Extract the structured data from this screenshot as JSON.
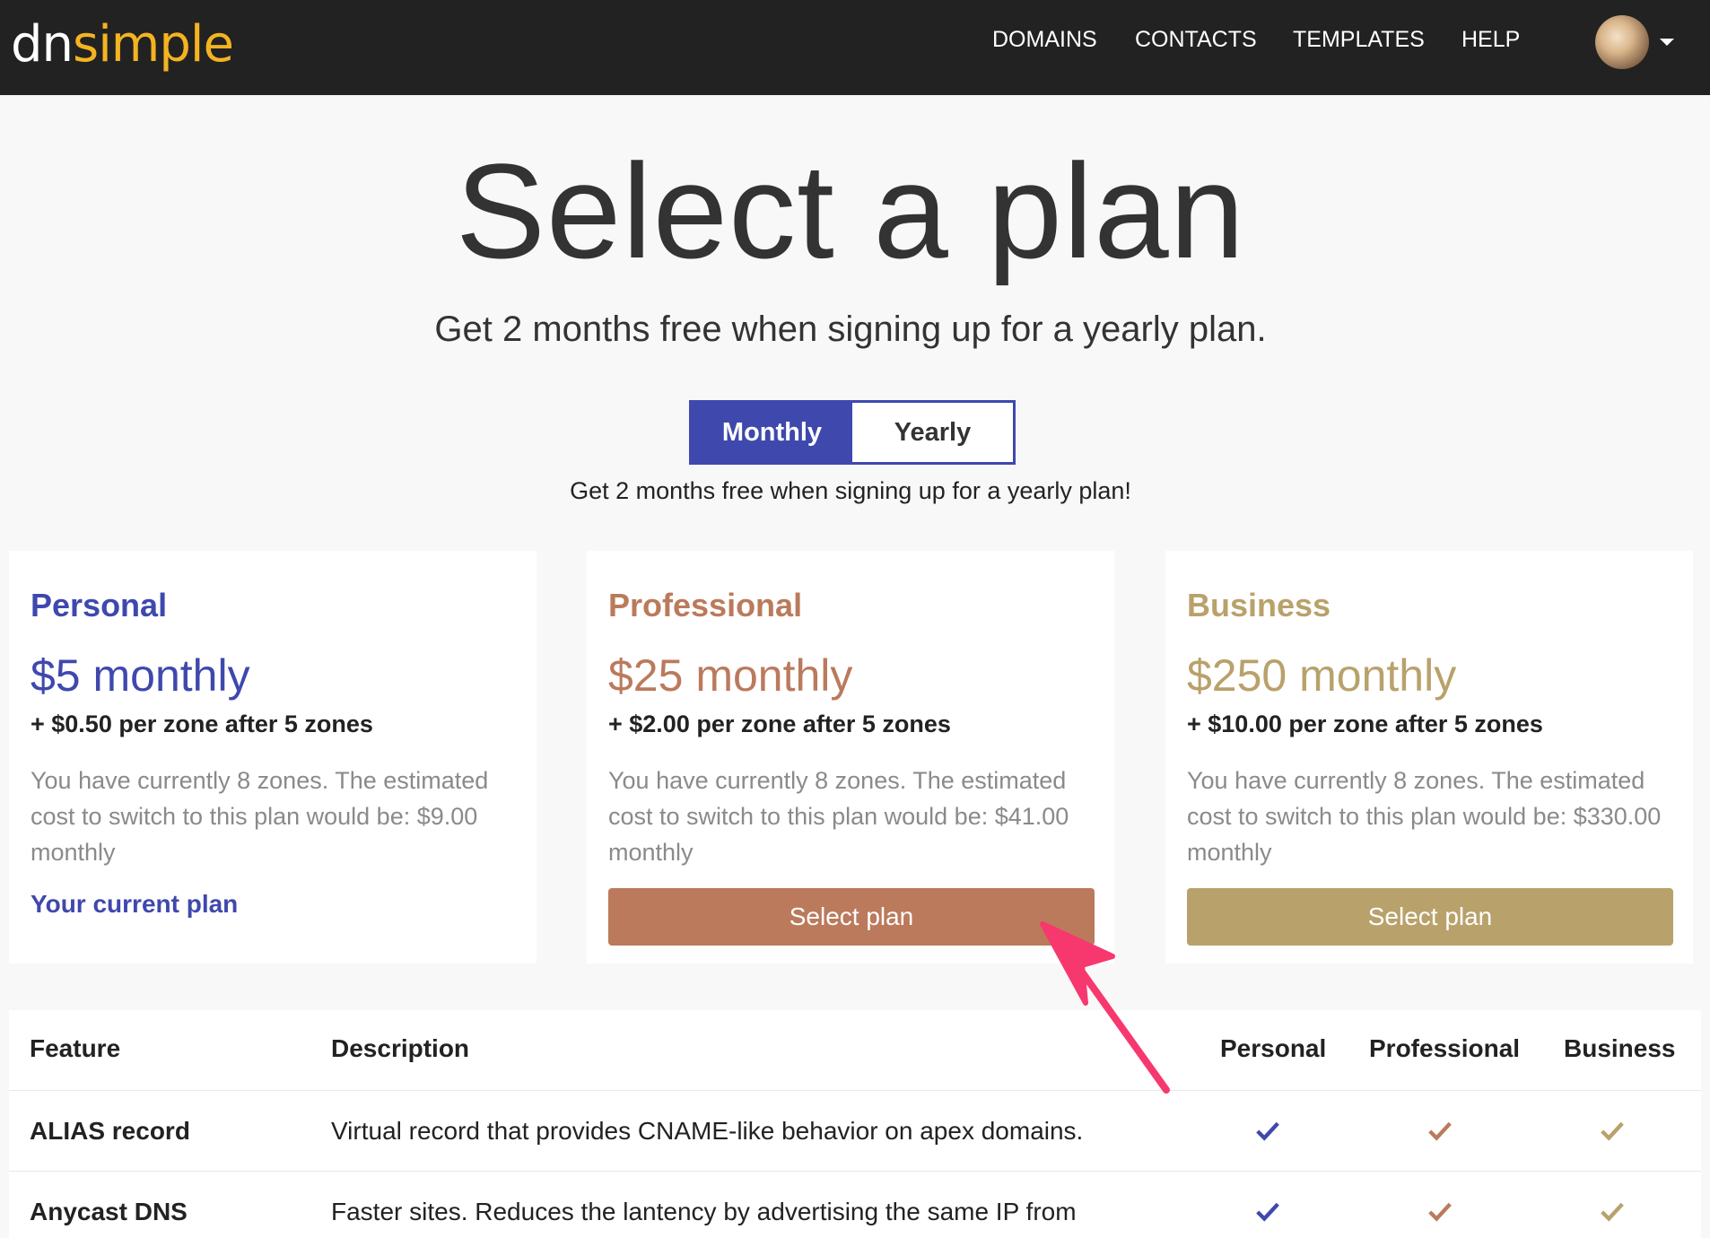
{
  "nav": {
    "logo_dn": "dn",
    "logo_simple": "simple",
    "items": [
      "DOMAINS",
      "CONTACTS",
      "TEMPLATES",
      "HELP"
    ]
  },
  "hero": {
    "title": "Select a plan",
    "subtitle": "Get 2 months free when signing up for a yearly plan.",
    "toggle": {
      "monthly": "Monthly",
      "yearly": "Yearly",
      "selected": "Monthly"
    },
    "toggle_note": "Get 2 months free when signing up for a yearly plan!"
  },
  "plans": [
    {
      "name": "Personal",
      "price": "$5 monthly",
      "extra": "+ $0.50 per zone after 5 zones",
      "desc": "You have currently 8 zones. The estimated cost to switch to this plan would be: $9.00 monthly",
      "status": "Your current plan",
      "color": "#3f48ad"
    },
    {
      "name": "Professional",
      "price": "$25 monthly",
      "extra": "+ $2.00 per zone after 5 zones",
      "desc": "You have currently 8 zones. The estimated cost to switch to this plan would be: $41.00 monthly",
      "button": "Select plan",
      "color": "#bb7a5c"
    },
    {
      "name": "Business",
      "price": "$250 monthly",
      "extra": "+ $10.00 per zone after 5 zones",
      "desc": "You have currently 8 zones. The estimated cost to switch to this plan would be: $330.00 monthly",
      "button": "Select plan",
      "color": "#b9a16b"
    }
  ],
  "features": {
    "headers": [
      "Feature",
      "Description",
      "Personal",
      "Professional",
      "Business"
    ],
    "rows": [
      {
        "feature": "ALIAS record",
        "desc": "Virtual record that provides CNAME-like behavior on apex domains.",
        "checks": [
          true,
          true,
          true
        ]
      },
      {
        "feature": "Anycast DNS",
        "desc": "Faster sites. Reduces the lantency by advertising the same IP from",
        "checks": [
          true,
          true,
          true
        ]
      }
    ]
  },
  "annotation": {
    "arrow_color": "#f7386f"
  }
}
